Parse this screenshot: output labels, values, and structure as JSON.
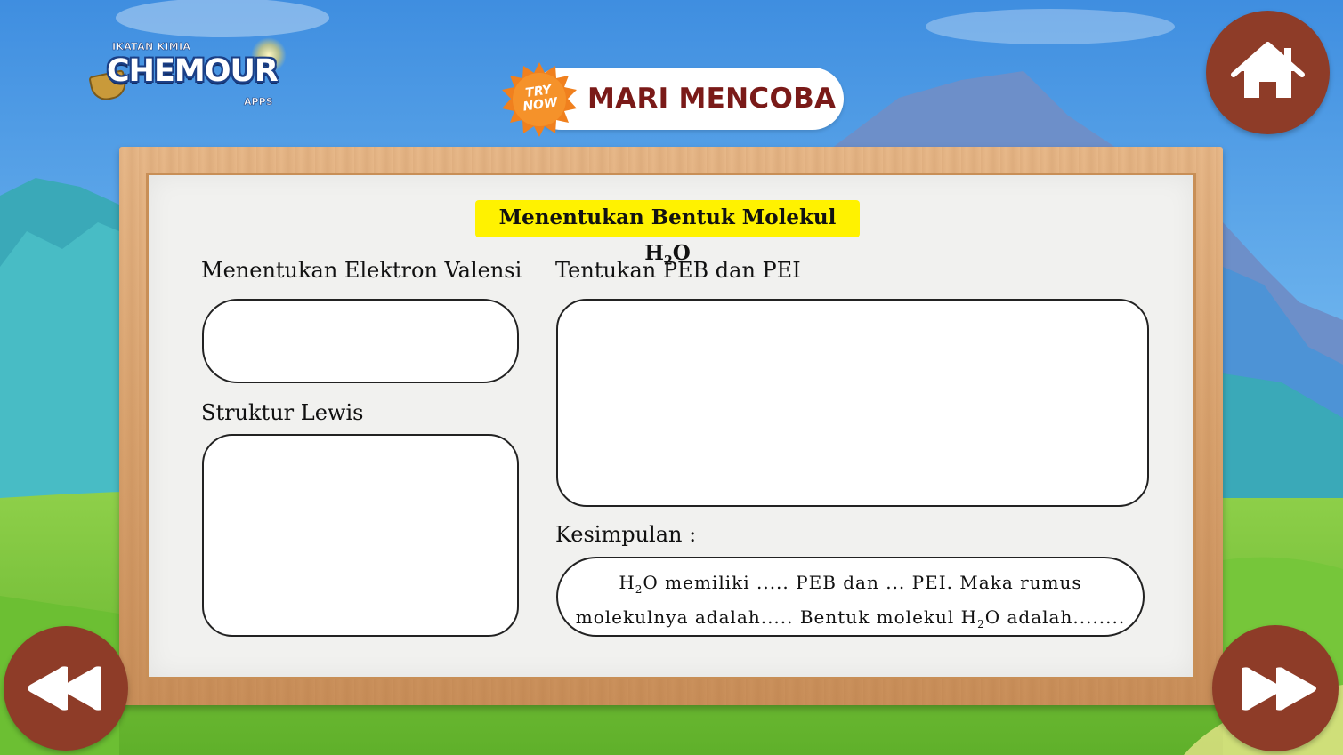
{
  "logo": {
    "top_line": "IKATAN KIMIA",
    "name": "CHEMOUR",
    "sub": "APPS"
  },
  "header": {
    "badge_line1": "TRY",
    "badge_line2": "NOW",
    "title": "MARI MENCOBA"
  },
  "nav": {
    "home_icon": "home-icon",
    "prev_icon": "rewind-icon",
    "next_icon": "fast-forward-icon"
  },
  "board": {
    "heading_prefix": "Menentukan Bentuk Molekul H",
    "heading_sub": "2",
    "heading_suffix": "O",
    "valensi_label": "Menentukan Elektron Valensi",
    "lewis_label": "Struktur Lewis",
    "peb_label": "Tentukan PEB dan PEI",
    "kesimpulan_label": "Kesimpulan :",
    "kesimpulan_line1_prefix": "H",
    "kesimpulan_line1_sub": "2",
    "kesimpulan_line1_suffix": "O memiliki ..... PEB dan ... PEI. Maka rumus",
    "kesimpulan_line2_prefix": "molekulnya adalah..... Bentuk molekul H",
    "kesimpulan_line2_sub": "2",
    "kesimpulan_line2_suffix": "O adalah........"
  },
  "colors": {
    "button_brown": "#8e3c28",
    "title_text": "#7a1a18",
    "heading_highlight": "#fff200",
    "badge_orange": "#f0801e"
  }
}
